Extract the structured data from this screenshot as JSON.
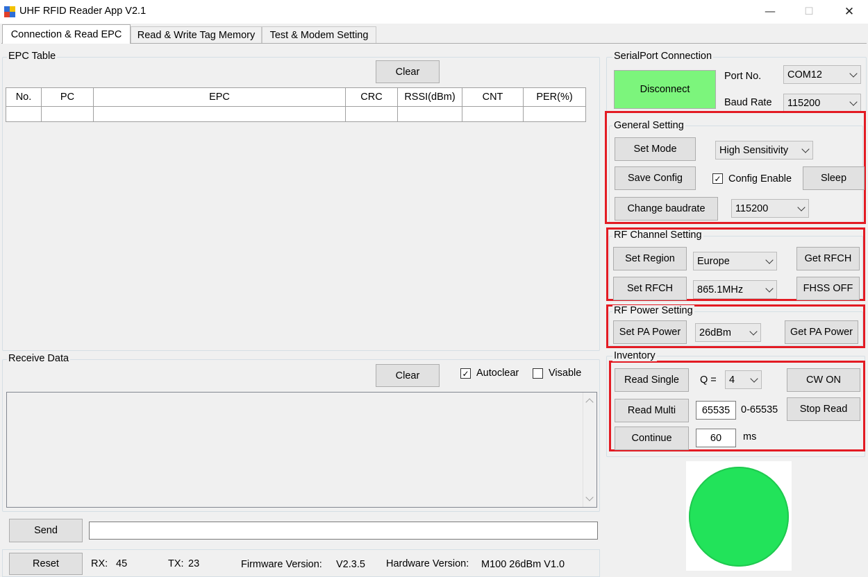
{
  "window": {
    "title": "UHF RFID Reader App V2.1",
    "controls": {
      "minimize": "—",
      "maximize": "☐",
      "close": "✕"
    }
  },
  "tabs": [
    {
      "label": "Connection & Read EPC",
      "active": true
    },
    {
      "label": "Read & Write Tag Memory",
      "active": false
    },
    {
      "label": "Test & Modem Setting",
      "active": false
    }
  ],
  "epc_table": {
    "group_label": "EPC Table",
    "clear_label": "Clear",
    "columns": [
      "No.",
      "PC",
      "EPC",
      "CRC",
      "RSSI(dBm)",
      "CNT",
      "PER(%)"
    ]
  },
  "receive": {
    "group_label": "Receive Data",
    "clear_label": "Clear",
    "autoclear_label": "Autoclear",
    "autoclear_checked": true,
    "visable_label": "Visable",
    "visable_checked": false
  },
  "send": {
    "button_label": "Send",
    "input_value": ""
  },
  "status": {
    "reset_label": "Reset",
    "rx_label": "RX:",
    "rx_value": "45",
    "tx_label": "TX:",
    "tx_value": "23",
    "firmware_label": "Firmware Version:",
    "firmware_value": "V2.3.5",
    "hardware_label": "Hardware Version:",
    "hardware_value": "M100 26dBm V1.0"
  },
  "serial": {
    "group_label": "SerialPort Connection",
    "disconnect_label": "Disconnect",
    "connect_color": "#7cf57c",
    "port_label": "Port No.",
    "port_value": "COM12",
    "baud_label": "Baud Rate",
    "baud_value": "115200"
  },
  "general": {
    "group_label": "General Setting",
    "set_mode_label": "Set Mode",
    "mode_value": "High Sensitivity",
    "save_config_label": "Save Config",
    "config_enable_label": "Config Enable",
    "config_enable_checked": true,
    "sleep_label": "Sleep",
    "change_baud_label": "Change baudrate",
    "baud_value": "115200"
  },
  "rf_channel": {
    "group_label": "RF Channel Setting",
    "set_region_label": "Set Region",
    "region_value": "Europe",
    "get_rfch_label": "Get RFCH",
    "set_rfch_label": "Set RFCH",
    "rfch_value": "865.1MHz",
    "fhss_label": "FHSS OFF"
  },
  "rf_power": {
    "group_label": "RF Power Setting",
    "set_pa_label": "Set PA Power",
    "pa_value": "26dBm",
    "get_pa_label": "Get PA Power"
  },
  "inventory": {
    "group_label": "Inventory",
    "read_single_label": "Read Single",
    "q_label": "Q =",
    "q_value": "4",
    "cw_label": "CW ON",
    "read_multi_label": "Read Multi",
    "multi_count_value": "65535",
    "range_label": "0-65535",
    "stop_read_label": "Stop Read",
    "continue_label": "Continue",
    "interval_value": "60",
    "ms_label": "ms"
  },
  "indicator": {
    "color": "#22e35a",
    "state": "connected"
  },
  "highlight_color": "#e31b23"
}
